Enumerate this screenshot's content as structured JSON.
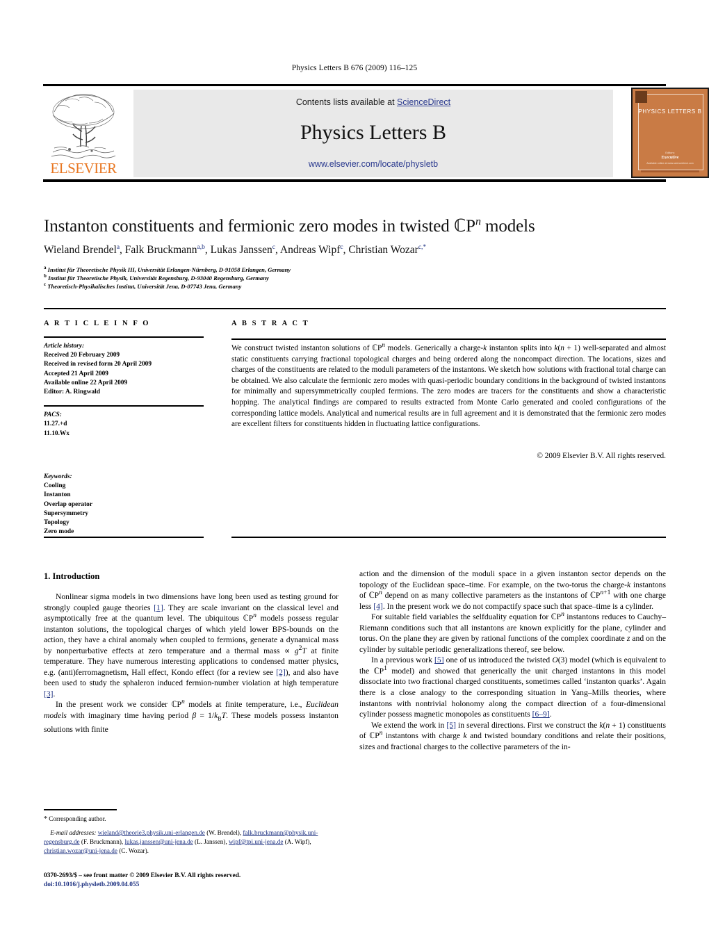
{
  "running_head": "Physics Letters B 676 (2009) 116–125",
  "masthead": {
    "contents_prefix": "Contents lists available at ",
    "sciencedirect": "ScienceDirect",
    "journal_name": "Physics Letters B",
    "journal_url": "www.elsevier.com/locate/physletb",
    "publisher_logo_text": "ELSEVIER",
    "accent_orange": "#E87722",
    "link_blue": "#2b3a8f"
  },
  "cover": {
    "title": "PHYSICS LETTERS B",
    "editors_label": "Editors:",
    "editors": "Executive",
    "sub": "Available online at www.sciencedirect.com",
    "background": "#C97B45"
  },
  "article": {
    "title_pre": "Instanton constituents and fermionic zero modes in twisted ",
    "title_symbol": "CP",
    "title_sup": "n",
    "title_post": " models",
    "authors": [
      {
        "name": "Wieland Brendel",
        "marks": "a"
      },
      {
        "name": "Falk Bruckmann",
        "marks": "a,b"
      },
      {
        "name": "Lukas Janssen",
        "marks": "c"
      },
      {
        "name": "Andreas Wipf",
        "marks": "c"
      },
      {
        "name": "Christian Wozar",
        "marks": "c,*"
      }
    ],
    "affiliations": [
      {
        "mark": "a",
        "text": "Institut für Theoretische Physik III, Universität Erlangen-Nürnberg, D-91058 Erlangen, Germany"
      },
      {
        "mark": "b",
        "text": "Institut für Theoretische Physik, Universität Regensburg, D-93040 Regensburg, Germany"
      },
      {
        "mark": "c",
        "text": "Theoretisch-Physikalisches Institut, Universität Jena, D-07743 Jena, Germany"
      }
    ]
  },
  "info_head": "A R T I C L E   I N F O",
  "abstract_head": "A B S T R A C T",
  "article_info": {
    "history_label": "Article history:",
    "history": [
      "Received 20 February 2009",
      "Received in revised form 20 April 2009",
      "Accepted 21 April 2009",
      "Available online 22 April 2009",
      "Editor: A. Ringwald"
    ],
    "pacs_label": "PACS:",
    "pacs": [
      "11.27.+d",
      "11.10.Wx"
    ],
    "keywords_label": "Keywords:",
    "keywords": [
      "Cooling",
      "Instanton",
      "Overlap operator",
      "Supersymmetry",
      "Topology",
      "Zero mode"
    ]
  },
  "abstract": {
    "text": "We construct twisted instanton solutions of CPn models. Generically a charge-k instanton splits into k(n + 1) well-separated and almost static constituents carrying fractional topological charges and being ordered along the noncompact direction. The locations, sizes and charges of the constituents are related to the moduli parameters of the instantons. We sketch how solutions with fractional total charge can be obtained. We also calculate the fermionic zero modes with quasi-periodic boundary conditions in the background of twisted instantons for minimally and supersymmetrically coupled fermions. The zero modes are tracers for the constituents and show a characteristic hopping. The analytical findings are compared to results extracted from Monte Carlo generated and cooled configurations of the corresponding lattice models. Analytical and numerical results are in full agreement and it is demonstrated that the fermionic zero modes are excellent filters for constituents hidden in fluctuating lattice configurations.",
    "copyright": "© 2009 Elsevier B.V. All rights reserved."
  },
  "body": {
    "section_number_title": "1. Introduction",
    "left_paragraph_1": "Nonlinear sigma models in two dimensions have long been used as testing ground for strongly coupled gauge theories [1]. They are scale invariant on the classical level and asymptotically free at the quantum level. The ubiquitous CPn models possess regular instanton solutions, the topological charges of which yield lower BPS-bounds on the action, they have a chiral anomaly when coupled to fermions, generate a dynamical mass by nonperturbative effects at zero temperature and a thermal mass ∝ g2T at finite temperature. They have numerous interesting applications to condensed matter physics, e.g. (anti)ferromagnetism, Hall effect, Kondo effect (for a review see [2]), and also have been used to study the sphaleron induced fermion-number violation at high temperature [3].",
    "left_paragraph_2": "In the present work we consider CPn models at finite temperature, i.e., Euclidean models with imaginary time having period β = 1/kBT. These models possess instanton solutions with finite",
    "right_paragraph_1": "action and the dimension of the moduli space in a given instanton sector depends on the topology of the Euclidean space–time. For example, on the two-torus the charge-k instantons of CPn depend on as many collective parameters as the instantons of CPn+1 with one charge less [4]. In the present work we do not compactify space such that space–time is a cylinder.",
    "right_paragraph_2": "For suitable field variables the selfduality equation for CPn instantons reduces to Cauchy–Riemann conditions such that all instantons are known explicitly for the plane, cylinder and torus. On the plane they are given by rational functions of the complex coordinate z and on the cylinder by suitable periodic generalizations thereof, see below.",
    "right_paragraph_3": "In a previous work [5] one of us introduced the twisted O(3) model (which is equivalent to the CP1 model) and showed that generically the unit charged instantons in this model dissociate into two fractional charged constituents, sometimes called 'instanton quarks'. Again there is a close analogy to the corresponding situation in Yang–Mills theories, where instantons with nontrivial holonomy along the compact direction of a four-dimensional cylinder possess magnetic monopoles as constituents [6–9].",
    "right_paragraph_4": "We extend the work in [5] in several directions. First we construct the k(n + 1) constituents of CPn instantons with charge k and twisted boundary conditions and relate their positions, sizes and fractional charges to the collective parameters of the in-"
  },
  "footnotes": {
    "corresponding_author": "Corresponding author.",
    "email_label": "E-mail addresses:",
    "emails": [
      {
        "address": "wieland@theorie3.physik.uni-erlangen.de",
        "who": "(W. Brendel)"
      },
      {
        "address": "falk.bruckmann@physik.uni-regensburg.de",
        "who": "(F. Bruckmann)"
      },
      {
        "address": "lukas.janssen@uni-jena.de",
        "who": "(L. Janssen)"
      },
      {
        "address": "wipf@tpi.uni-jena.de",
        "who": "(A. Wipf)"
      },
      {
        "address": "christian.wozar@uni-jena.de",
        "who": "(C. Wozar)"
      }
    ],
    "front_matter": "0370-2693/$ – see front matter © 2009 Elsevier B.V. All rights reserved.",
    "doi": "doi:10.1016/j.physletb.2009.04.055"
  }
}
